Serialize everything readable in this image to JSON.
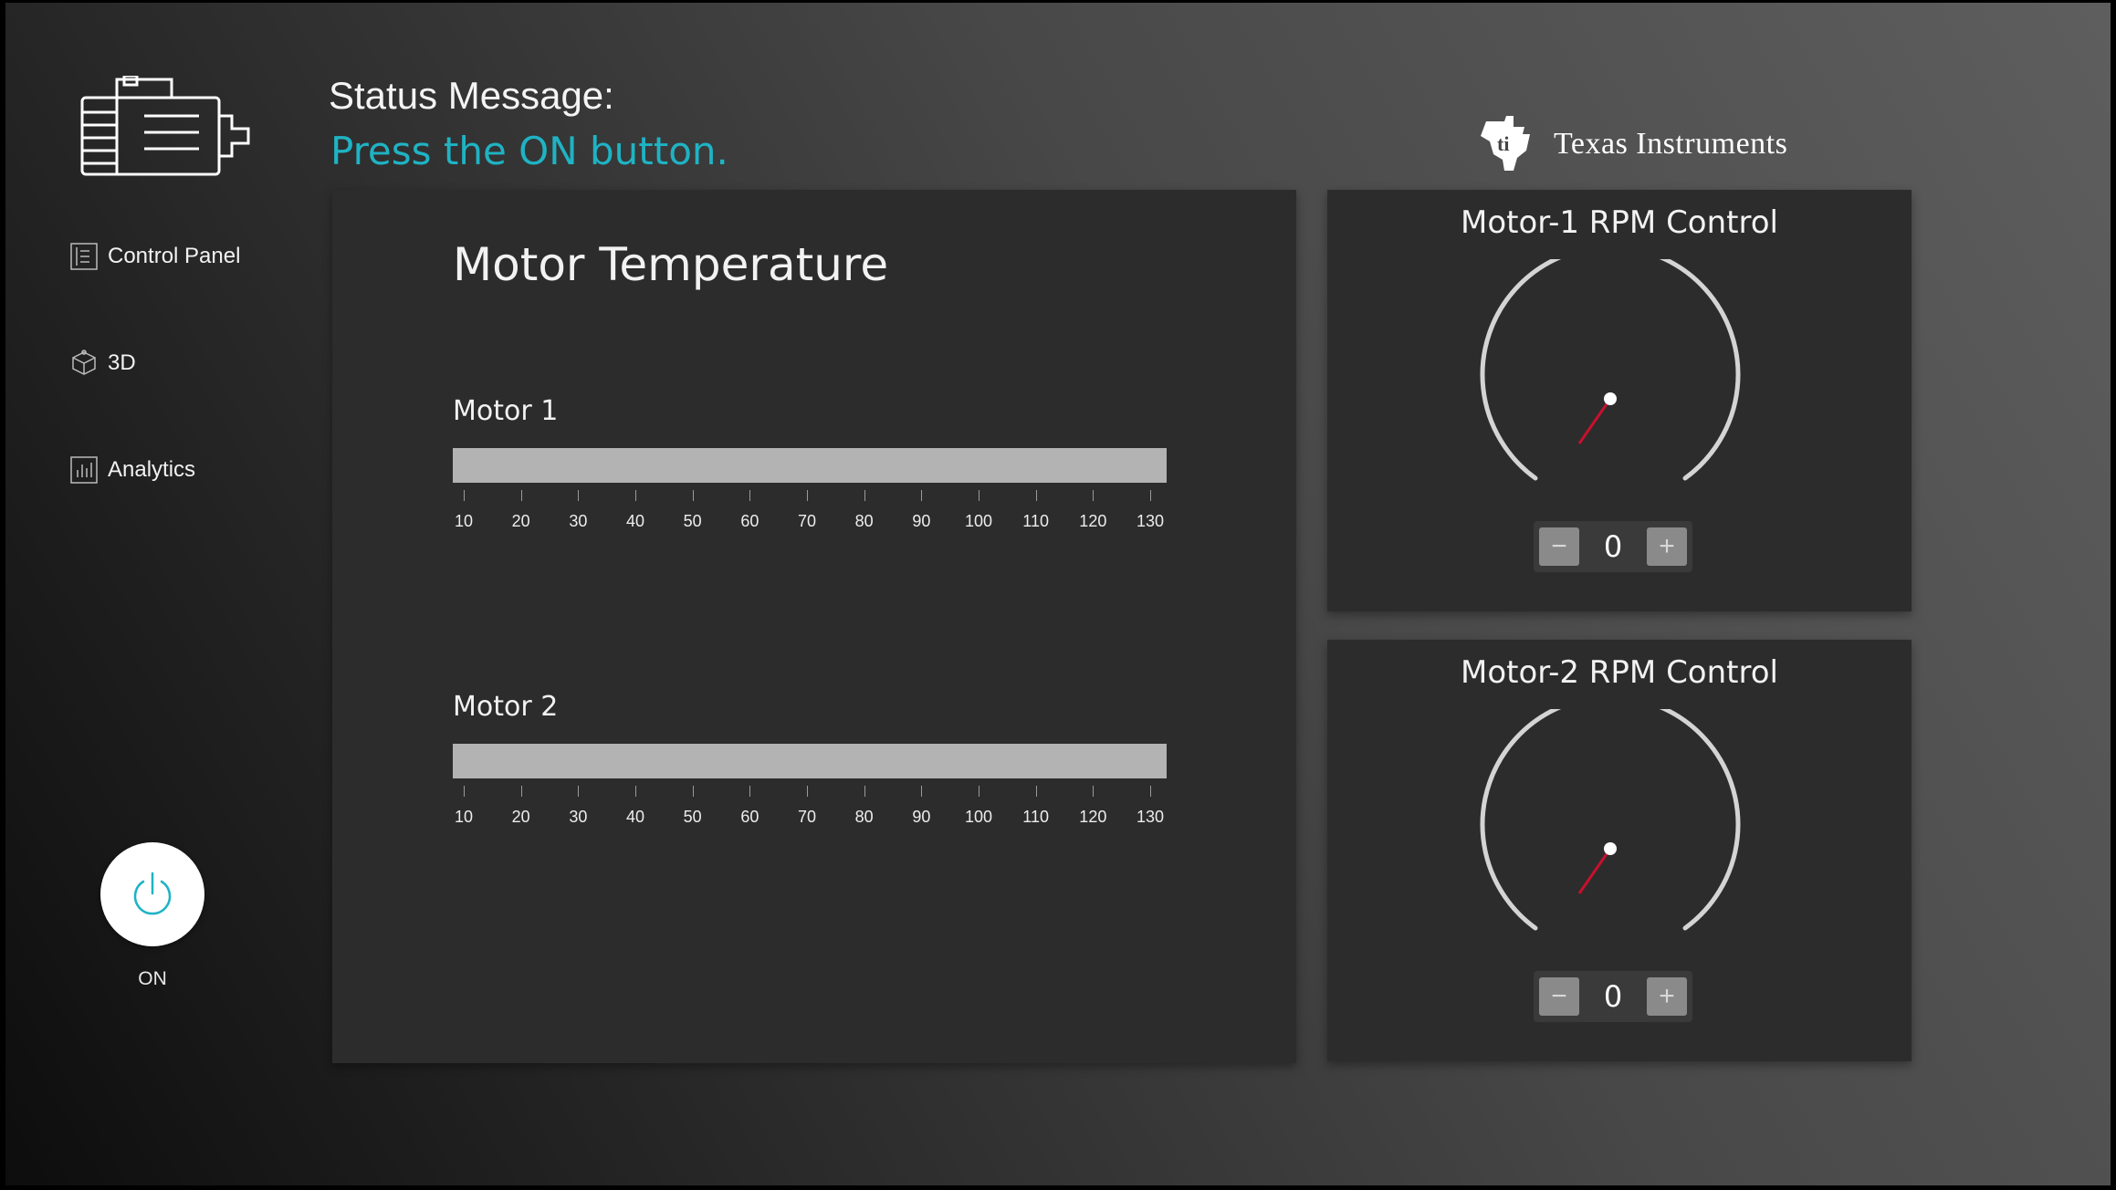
{
  "sidebar": {
    "items": [
      {
        "label": "Control Panel",
        "icon": "control-panel-icon"
      },
      {
        "label": "3D",
        "icon": "cube-3d-icon"
      },
      {
        "label": "Analytics",
        "icon": "analytics-icon"
      }
    ],
    "power": {
      "label": "ON",
      "icon": "power-icon"
    }
  },
  "header": {
    "status_title": "Status Message:",
    "status_text": "Press the ON button.",
    "brand": "Texas Instruments",
    "brand_logo_icon": "ti-logo-icon"
  },
  "temperature": {
    "title": "Motor Temperature",
    "scale_ticks": [
      "10",
      "20",
      "30",
      "40",
      "50",
      "60",
      "70",
      "80",
      "90",
      "100",
      "110",
      "120",
      "130"
    ],
    "motors": [
      {
        "label": "Motor 1",
        "value": null
      },
      {
        "label": "Motor 2",
        "value": null
      }
    ]
  },
  "rpm_controls": [
    {
      "title": "Motor-1 RPM Control",
      "value": "0",
      "minus": "−",
      "plus": "+"
    },
    {
      "title": "Motor-2 RPM Control",
      "value": "0",
      "minus": "−",
      "plus": "+"
    }
  ],
  "colors": {
    "accent": "#1fb3c4",
    "panel_bg": "#2c2c2c",
    "bar_bg": "#b3b3b3",
    "needle": "#c8102e"
  }
}
